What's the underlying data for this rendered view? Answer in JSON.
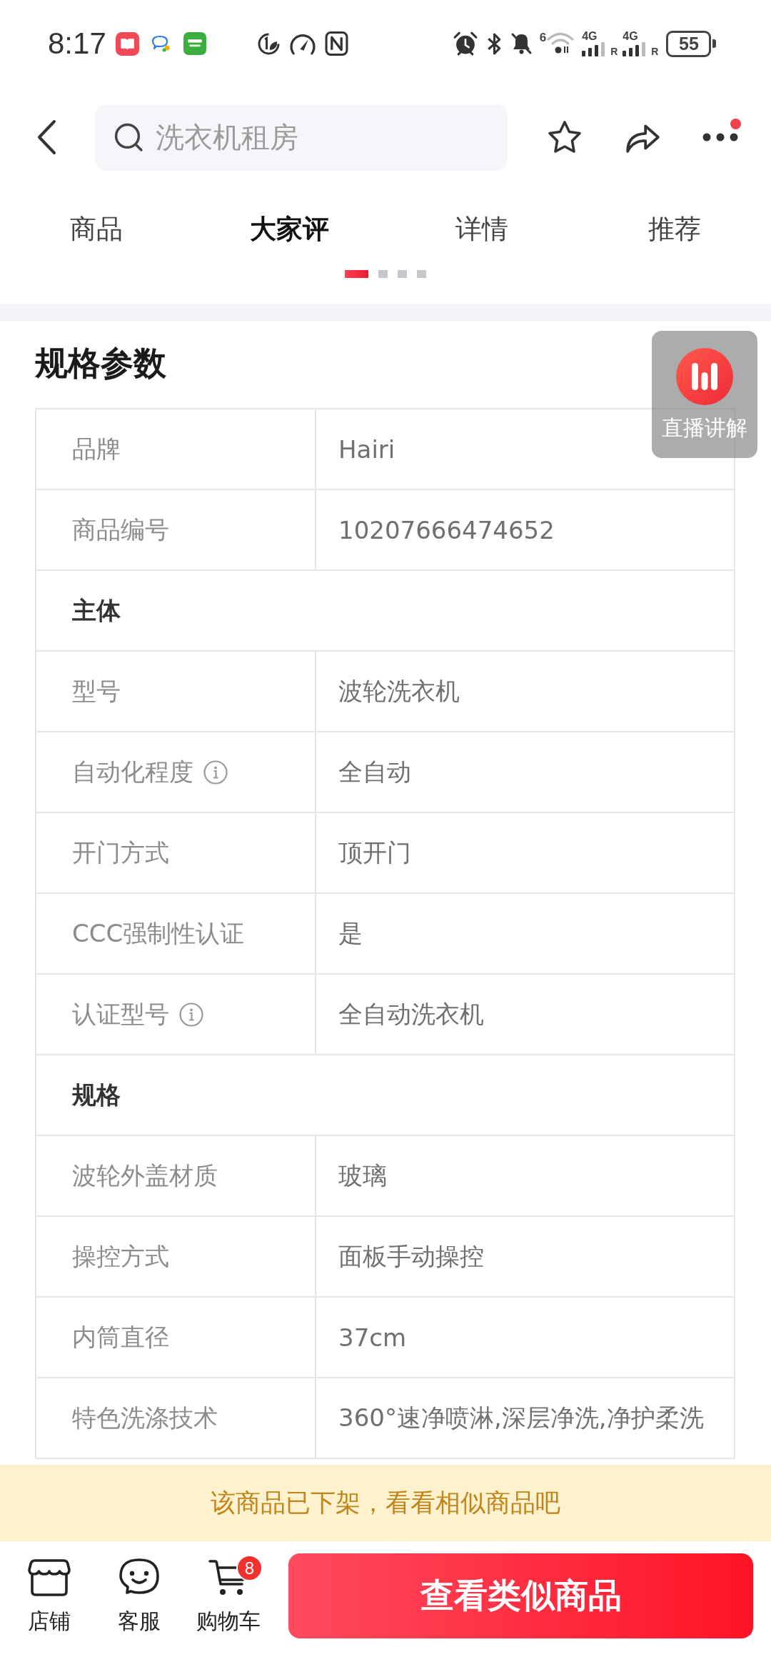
{
  "status_bar": {
    "time": "8:17",
    "wifi_label": "6",
    "signals": [
      {
        "network": "4G",
        "roaming": "R"
      },
      {
        "network": "4G",
        "roaming": "R"
      }
    ],
    "battery": "55"
  },
  "header": {
    "search": {
      "placeholder": "洗衣机租房"
    },
    "more_notification": true
  },
  "tabs": [
    {
      "label": "商品",
      "selected": false
    },
    {
      "label": "大家评",
      "selected": true
    },
    {
      "label": "详情",
      "selected": false
    },
    {
      "label": "推荐",
      "selected": false
    }
  ],
  "page_dots": [
    {
      "selected": true
    },
    {
      "selected": false
    },
    {
      "selected": false
    },
    {
      "selected": false
    }
  ],
  "specs": {
    "title": "规格参数",
    "rows": [
      {
        "kind": "spec",
        "label": "品牌",
        "value": "Hairi",
        "info": false
      },
      {
        "kind": "spec",
        "label": "商品编号",
        "value": "10207666474652",
        "info": false
      },
      {
        "kind": "section",
        "label": "主体",
        "info": false
      },
      {
        "kind": "spec",
        "label": "型号",
        "value": "波轮洗衣机",
        "info": false
      },
      {
        "kind": "spec",
        "label": "自动化程度",
        "value": "全自动",
        "info": true
      },
      {
        "kind": "spec",
        "label": "开门方式",
        "value": "顶开门",
        "info": false
      },
      {
        "kind": "spec",
        "label": "CCC强制性认证",
        "value": "是",
        "info": false
      },
      {
        "kind": "spec",
        "label": "认证型号",
        "value": "全自动洗衣机",
        "info": true
      },
      {
        "kind": "section",
        "label": "规格",
        "info": false
      },
      {
        "kind": "spec",
        "label": "波轮外盖材质",
        "value": "玻璃",
        "info": false
      },
      {
        "kind": "spec",
        "label": "操控方式",
        "value": "面板手动操控",
        "info": false
      },
      {
        "kind": "spec",
        "label": "内筒直径",
        "value": "37cm",
        "info": false
      },
      {
        "kind": "spec",
        "label": "特色洗涤技术",
        "value": "360°速净喷淋,深层净洗,净护柔洗",
        "info": false
      }
    ]
  },
  "live_button": {
    "label": "直播讲解"
  },
  "notice": "该商品已下架，看看相似商品吧",
  "bottom_bar": {
    "items": [
      {
        "kind": "store",
        "label": "店铺"
      },
      {
        "kind": "service",
        "label": "客服"
      },
      {
        "kind": "cart",
        "label": "购物车",
        "badge": "8"
      }
    ],
    "primary_button": "查看类似商品"
  }
}
